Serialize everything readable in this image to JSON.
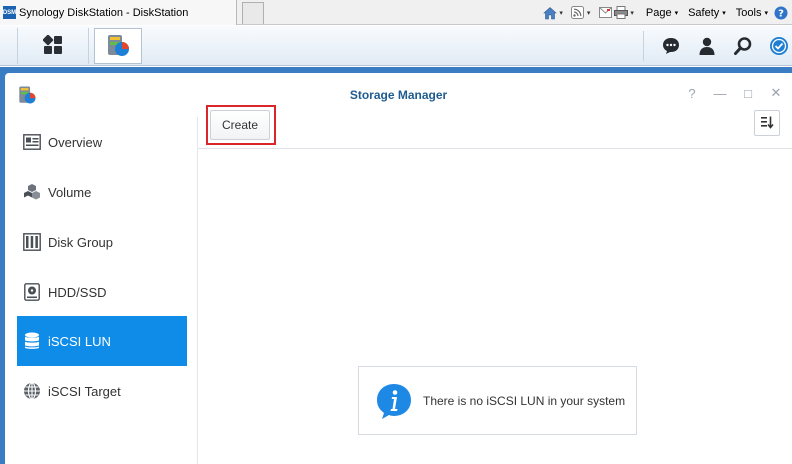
{
  "browser": {
    "tab_title": "Synology DiskStation - DiskStation",
    "favicon_text": "DSM",
    "menus": [
      {
        "label": "Page",
        "caret": "▾"
      },
      {
        "label": "Safety",
        "caret": "▾"
      },
      {
        "label": "Tools",
        "caret": "▾"
      }
    ],
    "icons": [
      "home-icon",
      "rss-feed-icon",
      "mail-icon",
      "print-icon",
      "page-menu",
      "safety-menu",
      "tools-menu",
      "help-icon"
    ]
  },
  "taskbar": {
    "icons": [
      "main-menu-icon",
      "storage-manager-taskbar-icon",
      "notifications-icon",
      "user-icon",
      "search-icon",
      "widgets-icon"
    ]
  },
  "window": {
    "title": "Storage Manager",
    "controls": {
      "help": "?",
      "minimize": "—",
      "maximize": "□",
      "close": "✕"
    }
  },
  "sidebar": {
    "items": [
      {
        "label": "Overview",
        "icon": "overview-icon",
        "active": false
      },
      {
        "label": "Volume",
        "icon": "volume-icon",
        "active": false
      },
      {
        "label": "Disk Group",
        "icon": "disk-group-icon",
        "active": false
      },
      {
        "label": "HDD/SSD",
        "icon": "hdd-icon",
        "active": false
      },
      {
        "label": "iSCSI LUN",
        "icon": "iscsi-lun-icon",
        "active": true
      },
      {
        "label": "iSCSI Target",
        "icon": "iscsi-target-icon",
        "active": false
      }
    ]
  },
  "toolbar": {
    "create_label": "Create",
    "sort_icon": "sort-icon"
  },
  "empty_state": {
    "message": "There is no iSCSI LUN in your system",
    "icon": "info-icon"
  },
  "colors": {
    "active_nav": "#0f8ce8",
    "title_text": "#1f5c91",
    "highlight": "#d9262b",
    "info_blue": "#1e88e5"
  }
}
